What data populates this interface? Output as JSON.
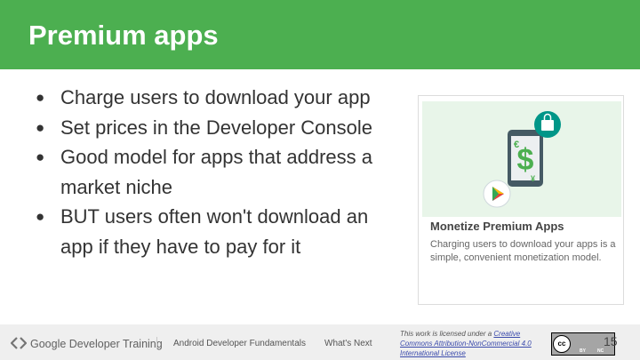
{
  "slide": {
    "title": "Premium apps",
    "bullets": [
      "Charge users to download your app",
      "Set prices in the Developer Console",
      "Good model for apps that address a market niche",
      "BUT users often won't download an app if they have to pay for it"
    ]
  },
  "card": {
    "title": "Monetize Premium Apps",
    "text": "Charging users to download your apps is a simple, convenient monetization model.",
    "icons": [
      "phone-icon",
      "dollar-icon",
      "euro-icon",
      "yen-icon",
      "play-store-icon",
      "shopping-bag-icon"
    ]
  },
  "footer": {
    "brand": "Google Developer Training",
    "course": "Android Developer Fundamentals",
    "next": "What's Next",
    "license_prefix": "This work is licensed under a ",
    "license_link": "Creative Commons Attribution-NonCommercial 4.0 International License",
    "cc_badge": "cc",
    "cc_by": "BY",
    "cc_nc": "NC",
    "page_number": "15"
  },
  "colors": {
    "header": "#4caf50",
    "footer_bg": "#efefef",
    "phone": "#455a64",
    "dollar": "#4caf50",
    "bag_circle": "#009688"
  }
}
